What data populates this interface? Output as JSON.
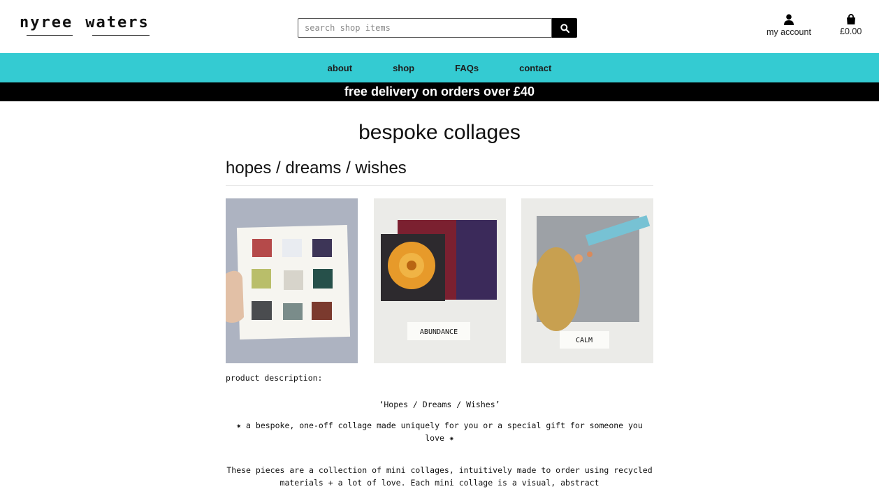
{
  "header": {
    "logo_word1": "nyree",
    "logo_word2": "waters",
    "search_placeholder": "search shop items",
    "account_label": "my account",
    "bag_total": "£0.00"
  },
  "nav": {
    "items": [
      "about",
      "shop",
      "FAQs",
      "contact"
    ]
  },
  "promo": "free delivery on orders over £40",
  "main": {
    "page_title": "bespoke collages",
    "product_title": "hopes / dreams / wishes",
    "images": [
      {
        "caption": ""
      },
      {
        "caption": "ABUNDANCE"
      },
      {
        "caption": "CALM"
      }
    ],
    "description_label": "product description:",
    "description_heading": "‘Hopes / Dreams / Wishes’",
    "tagline": "✷ a bespoke, one-off collage made uniquely for you or a special gift for someone you love ✷",
    "paragraph": "These pieces are a collection of mini collages, intuitively made to order using recycled materials + a lot of love. Each mini collage is a visual, abstract"
  },
  "colors": {
    "nav_bg": "#34cbd2",
    "promo_bg": "#000000"
  },
  "icons": {
    "search": "search-icon",
    "account": "user-icon",
    "bag": "shopping-bag-icon"
  }
}
